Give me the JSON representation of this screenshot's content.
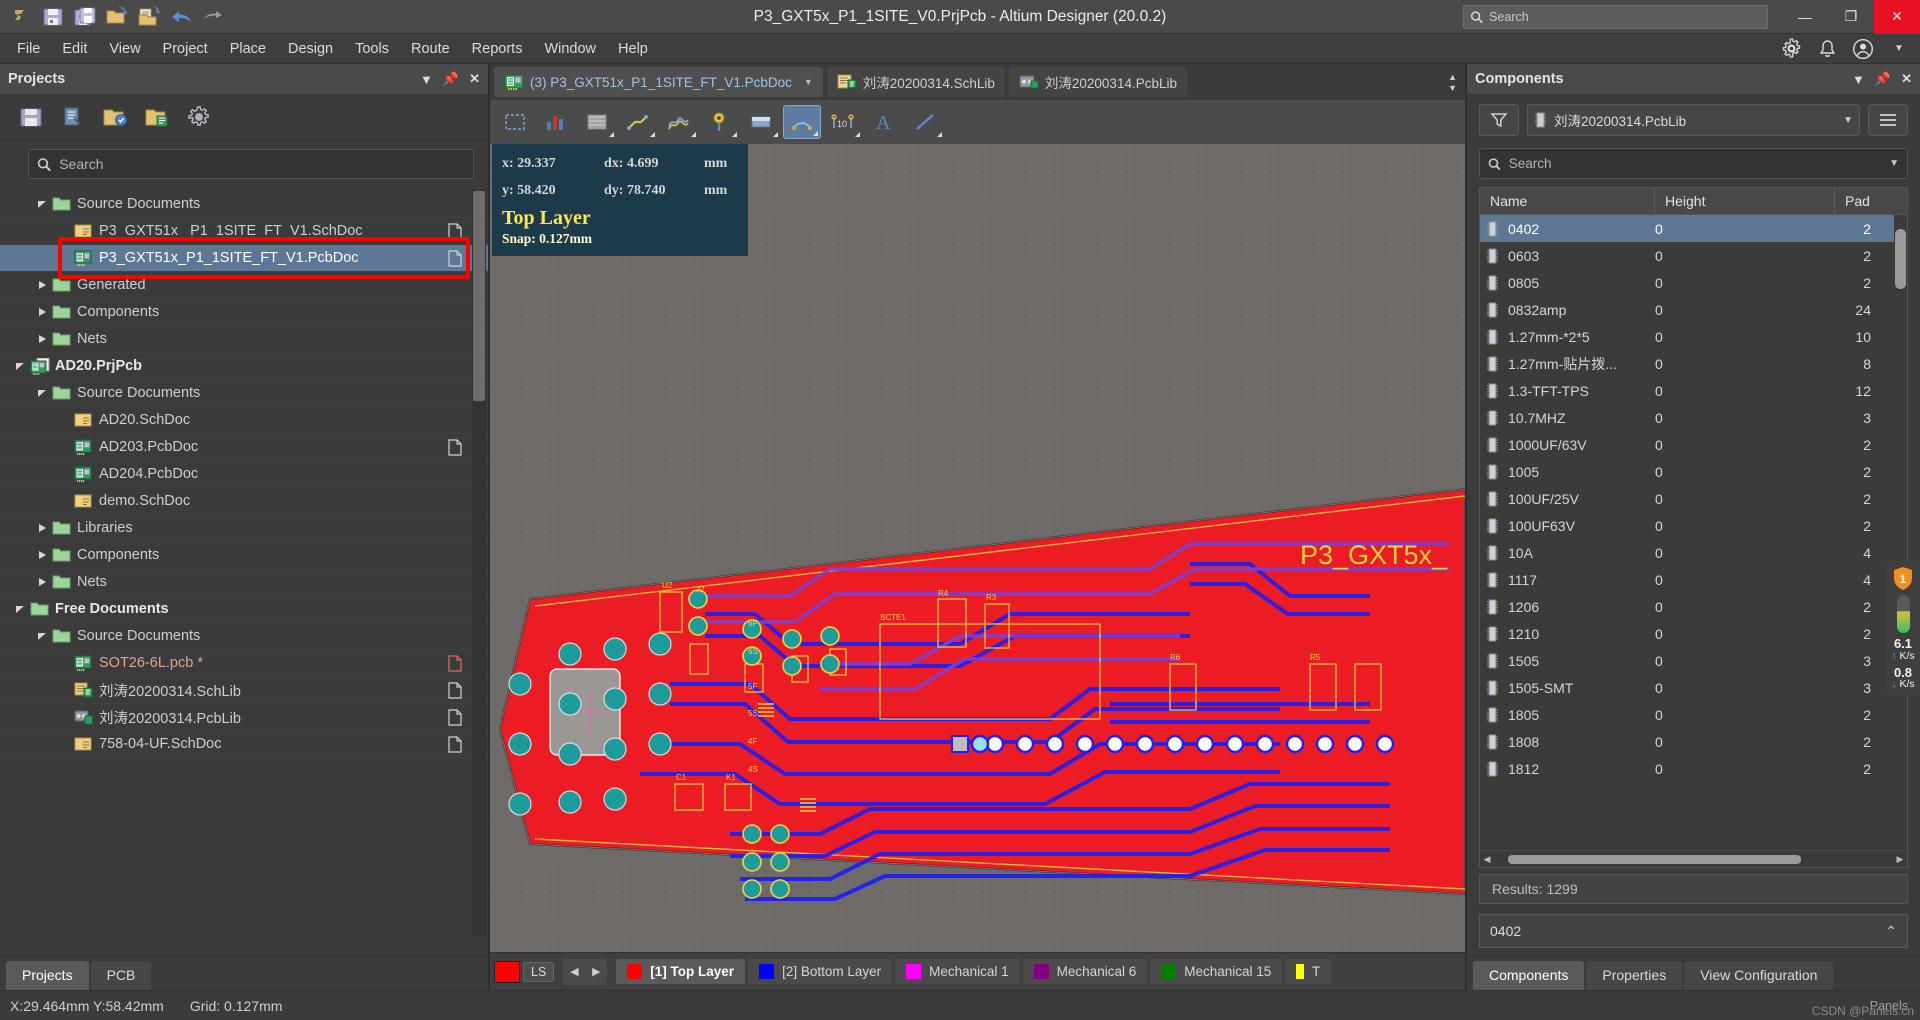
{
  "window": {
    "title": "P3_GXT5x_P1_1SITE_V0.PrjPcb - Altium Designer (20.0.2)",
    "search_placeholder": "Search",
    "minimize": "—",
    "maximize": "❐",
    "close": "✕"
  },
  "menu": {
    "items": [
      "File",
      "Edit",
      "View",
      "Project",
      "Place",
      "Design",
      "Tools",
      "Route",
      "Reports",
      "Window",
      "Help"
    ]
  },
  "projects_panel": {
    "title": "Projects",
    "search_placeholder": "Search",
    "toolbar_icons": [
      "save-icon",
      "compile-icon",
      "open-folder-icon",
      "project-options-icon",
      "settings-gear-icon"
    ],
    "tree": [
      {
        "label": "Source Documents",
        "indent": 1,
        "type": "folder",
        "expanded": true,
        "bold": false
      },
      {
        "label": "P3_GXT51x_ P1_1SITE_FT_V1.SchDoc",
        "indent": 2,
        "type": "sch",
        "doc": true
      },
      {
        "label": "P3_GXT51x_P1_1SITE_FT_V1.PcbDoc",
        "indent": 2,
        "type": "pcb",
        "doc": true,
        "selected": true,
        "highlighted": true
      },
      {
        "label": "Generated",
        "indent": 1,
        "type": "folder",
        "collapsed": true
      },
      {
        "label": "Components",
        "indent": 1,
        "type": "folder",
        "collapsed": true
      },
      {
        "label": "Nets",
        "indent": 1,
        "type": "folder",
        "collapsed": true
      },
      {
        "label": "AD20.PrjPcb",
        "indent": 0,
        "type": "project",
        "expanded": true,
        "bold": true
      },
      {
        "label": "Source Documents",
        "indent": 1,
        "type": "folder",
        "expanded": true
      },
      {
        "label": "AD20.SchDoc",
        "indent": 2,
        "type": "sch"
      },
      {
        "label": "AD203.PcbDoc",
        "indent": 2,
        "type": "pcb",
        "doc": true
      },
      {
        "label": "AD204.PcbDoc",
        "indent": 2,
        "type": "pcb"
      },
      {
        "label": "demo.SchDoc",
        "indent": 2,
        "type": "sch"
      },
      {
        "label": "Libraries",
        "indent": 1,
        "type": "folder",
        "collapsed": true
      },
      {
        "label": "Components",
        "indent": 1,
        "type": "folder",
        "collapsed": true
      },
      {
        "label": "Nets",
        "indent": 1,
        "type": "folder",
        "collapsed": true
      },
      {
        "label": "Free Documents",
        "indent": 0,
        "type": "folder",
        "expanded": true,
        "bold": true
      },
      {
        "label": "Source Documents",
        "indent": 1,
        "type": "folder",
        "expanded": true
      },
      {
        "label": "SOT26-6L.pcb *",
        "indent": 2,
        "type": "pcb",
        "doc": true,
        "red": true
      },
      {
        "label": "刘涛20200314.SchLib",
        "indent": 2,
        "type": "schlib",
        "doc": true
      },
      {
        "label": "刘涛20200314.PcbLib",
        "indent": 2,
        "type": "pcblib",
        "doc": true
      },
      {
        "label": "758-04-UF.SchDoc",
        "indent": 2,
        "type": "sch",
        "doc": true
      }
    ],
    "tabs": [
      {
        "label": "Projects",
        "active": true
      },
      {
        "label": "PCB",
        "active": false
      }
    ]
  },
  "editor": {
    "doc_tabs": [
      {
        "label": "(3) P3_GXT51x_P1_1SITE_FT_V1.PcbDoc",
        "icon": "pcb-icon",
        "active": true,
        "has_caret": true
      },
      {
        "label": "刘涛20200314.SchLib",
        "icon": "schlib-icon",
        "active": false
      },
      {
        "label": "刘涛20200314.PcbLib",
        "icon": "pcblib-icon",
        "active": false
      }
    ],
    "toolbar_icons": [
      "select-area-icon",
      "bar-chart-icon",
      "polygon-pour-icon",
      "route-trace-icon",
      "differential-pair-icon",
      "via-icon",
      "fill-region-icon",
      "arc-icon",
      "dimension-icon",
      "text-string-icon",
      "line-icon"
    ],
    "coord_overlay": {
      "x_label": "x:",
      "x_value": "29.337",
      "dx_label": "dx:",
      "dx_value": "4.699",
      "dx_unit": "mm",
      "y_label": "y:",
      "y_value": "58.420",
      "dy_label": "dy:",
      "dy_value": "78.740",
      "dy_unit": "mm",
      "layer": "Top Layer",
      "snap": "Snap: 0.127mm"
    },
    "board_text": "P3_GXT5x_",
    "layer_bar": {
      "swatch_color": "#ff0000",
      "ls_label": "LS",
      "layers": [
        {
          "label": "[1] Top Layer",
          "color": "#ff0000",
          "active": true
        },
        {
          "label": "[2] Bottom Layer",
          "color": "#0000ff",
          "active": false
        },
        {
          "label": "Mechanical 1",
          "color": "#ff00ff",
          "active": false
        },
        {
          "label": "Mechanical 6",
          "color": "#800080",
          "active": false
        },
        {
          "label": "Mechanical 15",
          "color": "#008000",
          "active": false
        },
        {
          "label": "T",
          "color": "#ffff00",
          "active": false
        }
      ]
    }
  },
  "components_panel": {
    "title": "Components",
    "library": "刘涛20200314.PcbLib",
    "search_placeholder": "Search",
    "columns": [
      "Name",
      "Height",
      "Pad"
    ],
    "rows": [
      {
        "name": "0402",
        "height": "0",
        "pad": "2",
        "selected": true
      },
      {
        "name": "0603",
        "height": "0",
        "pad": "2"
      },
      {
        "name": "0805",
        "height": "0",
        "pad": "2"
      },
      {
        "name": "0832amp",
        "height": "0",
        "pad": "24"
      },
      {
        "name": "1.27mm-*2*5",
        "height": "0",
        "pad": "10"
      },
      {
        "name": "1.27mm-贴片拨...",
        "height": "0",
        "pad": "8"
      },
      {
        "name": "1.3-TFT-TPS",
        "height": "0",
        "pad": "12"
      },
      {
        "name": "10.7MHZ",
        "height": "0",
        "pad": "3"
      },
      {
        "name": "1000UF/63V",
        "height": "0",
        "pad": "2"
      },
      {
        "name": "1005",
        "height": "0",
        "pad": "2"
      },
      {
        "name": "100UF/25V",
        "height": "0",
        "pad": "2"
      },
      {
        "name": "100UF63V",
        "height": "0",
        "pad": "2"
      },
      {
        "name": "10A",
        "height": "0",
        "pad": "4"
      },
      {
        "name": "1117",
        "height": "0",
        "pad": "4"
      },
      {
        "name": "1206",
        "height": "0",
        "pad": "2"
      },
      {
        "name": "1210",
        "height": "0",
        "pad": "2"
      },
      {
        "name": "1505",
        "height": "0",
        "pad": "3"
      },
      {
        "name": "1505-SMT",
        "height": "0",
        "pad": "3"
      },
      {
        "name": "1805",
        "height": "0",
        "pad": "2"
      },
      {
        "name": "1808",
        "height": "0",
        "pad": "2"
      },
      {
        "name": "1812",
        "height": "0",
        "pad": "2"
      }
    ],
    "results": "Results: 1299",
    "footer_value": "0402",
    "tabs": [
      {
        "label": "Components",
        "active": true
      },
      {
        "label": "Properties",
        "active": false
      },
      {
        "label": "View Configuration",
        "active": false
      }
    ]
  },
  "status_bar": {
    "coords": "X:29.464mm Y:58.42mm",
    "grid": "Grid: 0.127mm",
    "panels": "Panels"
  },
  "edge_widgets": {
    "shield_count": "1",
    "upload_rate": "6.1",
    "upload_unit": "K/s",
    "download_rate": "0.8",
    "download_unit": "K/s"
  },
  "watermark": "CSDN @Panels.cn",
  "colors": {
    "accent": "#5d7795",
    "top_layer": "#ff0000",
    "bottom_layer": "#0000ff",
    "highlight_red": "#ff0000",
    "overlay_bg": "#1d3a4a",
    "overlay_text": "#ffffcc"
  }
}
